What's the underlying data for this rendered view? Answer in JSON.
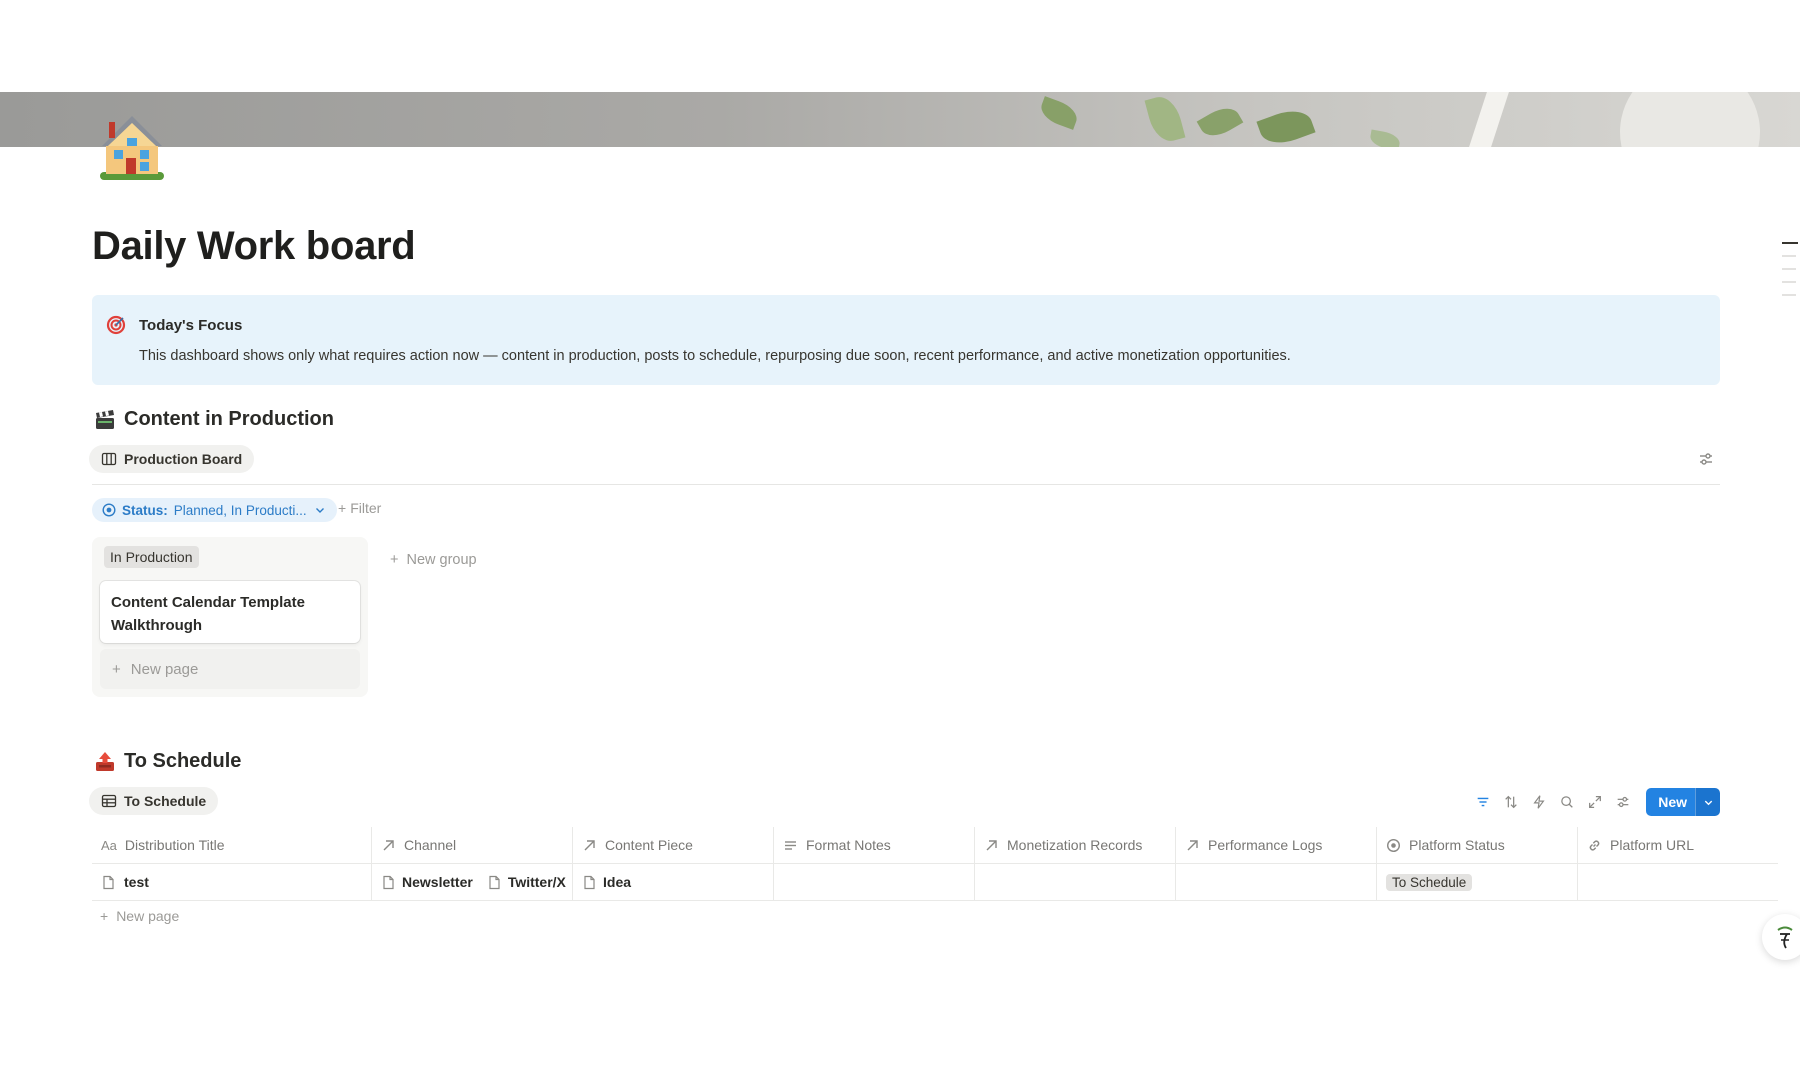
{
  "page": {
    "title": "Daily Work board",
    "icon": "house-icon"
  },
  "callout": {
    "icon": "target-icon",
    "title": "Today's Focus",
    "body": "This dashboard shows only what requires action now — content in production, posts to schedule, repurposing due soon, recent performance, and active monetization opportunities."
  },
  "production": {
    "icon": "clapperboard-icon",
    "title": "Content in Production",
    "view_tab": "Production Board",
    "filter": {
      "key": "Status:",
      "value": "Planned, In Producti..."
    },
    "add_filter": "Filter",
    "group_label": "In Production",
    "cards": [
      "Content Calendar Template Walkthrough"
    ],
    "new_page": "New page",
    "new_group": "New group"
  },
  "schedule": {
    "icon": "outbox-tray-icon",
    "title": "To Schedule",
    "view_tab": "To Schedule",
    "new_button": "New",
    "columns": [
      {
        "label": "Distribution Title",
        "icon": "title-icon"
      },
      {
        "label": "Channel",
        "icon": "relation-icon"
      },
      {
        "label": "Content Piece",
        "icon": "relation-icon"
      },
      {
        "label": "Format Notes",
        "icon": "text-icon"
      },
      {
        "label": "Monetization Records",
        "icon": "relation-icon"
      },
      {
        "label": "Performance Logs",
        "icon": "relation-icon"
      },
      {
        "label": "Platform Status",
        "icon": "status-icon"
      },
      {
        "label": "Platform URL",
        "icon": "link-icon"
      }
    ],
    "rows": [
      {
        "title": "test",
        "channel": [
          "Newsletter",
          "Twitter/X"
        ],
        "content_piece": "Idea",
        "format_notes": "",
        "monetization": "",
        "performance": "",
        "platform_status": "To Schedule",
        "platform_url": ""
      }
    ],
    "new_page": "New page"
  },
  "colors": {
    "accent": "#2383e2",
    "callout_bg": "#e7f3fb",
    "filter_text": "#2c7cc7"
  }
}
